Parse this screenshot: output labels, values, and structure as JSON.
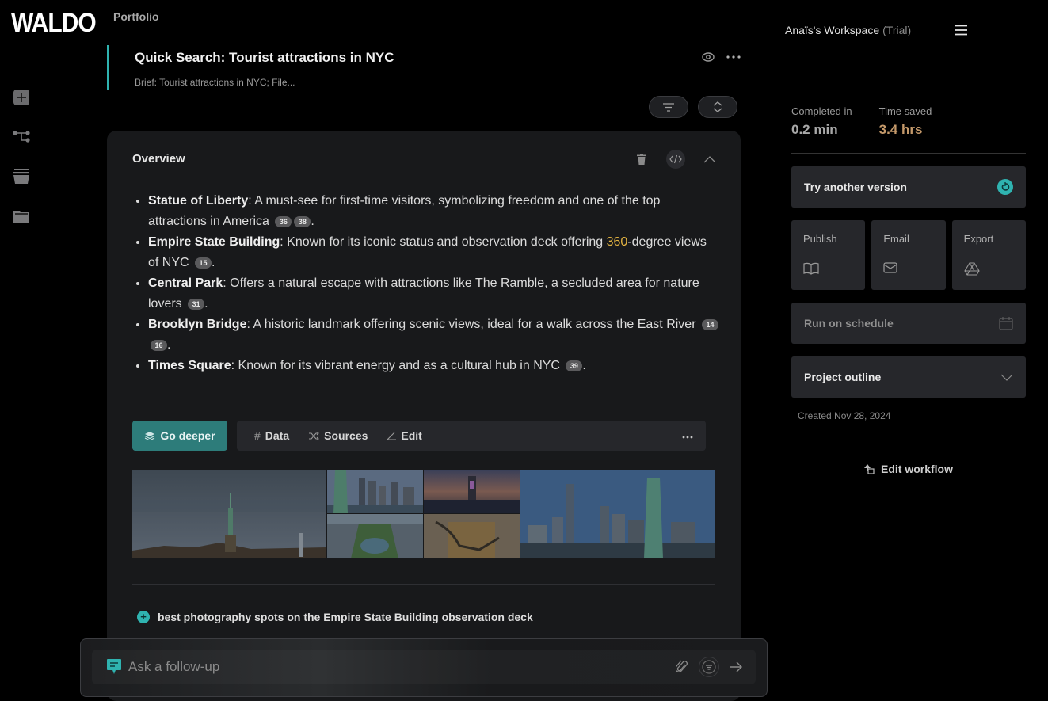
{
  "app": {
    "logo": "WALDO",
    "breadcrumb": "Portfolio"
  },
  "sidenav": {
    "items": [
      {
        "name": "new",
        "icon": "plus-square-icon"
      },
      {
        "name": "workflow",
        "icon": "tree-icon"
      },
      {
        "name": "library",
        "icon": "stack-icon"
      },
      {
        "name": "folders",
        "icon": "folder-icon"
      }
    ]
  },
  "project": {
    "title": "Quick Search: Tourist attractions in NYC",
    "brief": "Brief: Tourist attractions in NYC; File..."
  },
  "overview": {
    "title": "Overview",
    "items": [
      {
        "name": "Statue of Liberty",
        "text": ": A must-see for first-time visitors, symbolizing freedom and one of the top attractions in America",
        "cites": [
          "36",
          "38"
        ]
      },
      {
        "name": "Empire State Building",
        "text_before": ": Known for its iconic status and observation deck offering ",
        "highlight": "360",
        "text_after": "-degree views of NYC",
        "cites": [
          "15"
        ]
      },
      {
        "name": "Central Park",
        "text": ": Offers a natural escape with attractions like The Ramble, a secluded area for nature lovers",
        "cites": [
          "31"
        ]
      },
      {
        "name": "Brooklyn Bridge",
        "text": ": A historic landmark offering scenic views, ideal for a walk across the East River",
        "cites": [
          "14",
          "16"
        ]
      },
      {
        "name": "Times Square",
        "text": ": Known for its vibrant energy and as a cultural hub in NYC",
        "cites": [
          "39"
        ]
      }
    ],
    "period": "."
  },
  "actions": {
    "go_deeper": "Go deeper",
    "data": "Data",
    "sources": "Sources",
    "edit": "Edit"
  },
  "gallery": {
    "images": [
      "Statue of Liberty at dusk",
      "Statue of Liberty with Manhattan skyline",
      "Empire State Building at night",
      "Central Park aerial view",
      "Dinosaur skeleton at museum",
      "Statue of Liberty with Lower Manhattan"
    ]
  },
  "suggestion": "best photography spots on the Empire State Building observation deck",
  "followup": {
    "placeholder": "Ask a follow-up"
  },
  "workspace": {
    "name": "Anaïs's Workspace",
    "plan": "(Trial)"
  },
  "stats": {
    "completed_label": "Completed in",
    "completed_value": "0.2 min",
    "saved_label": "Time saved",
    "saved_value": "3.4 hrs"
  },
  "panel": {
    "try_another": "Try another version",
    "publish": "Publish",
    "email": "Email",
    "export": "Export",
    "schedule": "Run on schedule",
    "outline": "Project outline",
    "created": "Created Nov 28, 2024",
    "edit_workflow": "Edit workflow"
  },
  "colors": {
    "accent": "#2fb3b0",
    "go_deeper": "#2d7c7a",
    "highlight": "#e3b341",
    "time_saved": "#c4996a"
  }
}
